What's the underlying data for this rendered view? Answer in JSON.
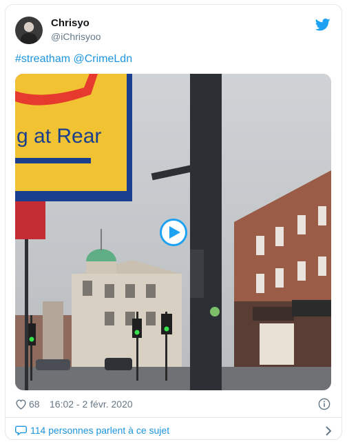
{
  "user": {
    "display_name": "Chrisyo",
    "handle": "@iChrisyoo"
  },
  "tweet": {
    "hashtag": "#streatham",
    "mention": "@CrimeLdn",
    "sign_text": "g at Rear"
  },
  "meta": {
    "likes": "68",
    "timestamp": "16:02 - 2 févr. 2020"
  },
  "footer": {
    "conversation": "114 personnes parlent à ce sujet"
  },
  "icons": {
    "brand": "twitter-bird-icon",
    "like": "heart-icon",
    "info": "info-icon",
    "reply": "speech-bubble-icon",
    "next": "chevron-right-icon",
    "play": "play-icon"
  },
  "colors": {
    "link": "#1b95e0",
    "brand": "#1da1f2",
    "muted": "#657786"
  }
}
